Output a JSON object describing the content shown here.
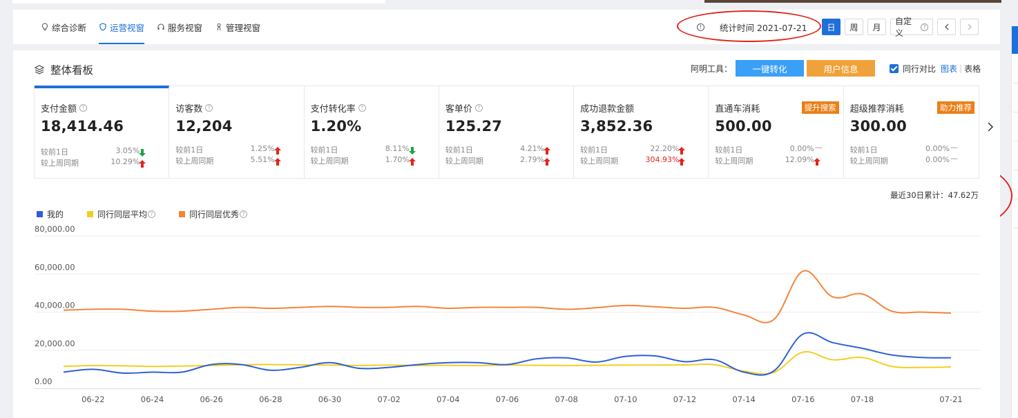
{
  "tabs": [
    {
      "label": "综合诊断",
      "icon": "bulb-icon",
      "active": false
    },
    {
      "label": "运营视窗",
      "icon": "shield-icon",
      "active": true
    },
    {
      "label": "服务视窗",
      "icon": "headset-icon",
      "active": false
    },
    {
      "label": "管理视窗",
      "icon": "user-icon",
      "active": false
    }
  ],
  "stat_time": "统计时间 2021-07-21",
  "period_buttons": {
    "day": "日",
    "week": "周",
    "month": "月",
    "custom": "自定义"
  },
  "panel": {
    "title": "整体看板",
    "tools_label": "阿明工具：",
    "btn_convert": "一键转化",
    "btn_userinfo": "用户信息",
    "compare_label": "同行对比",
    "view_chart": "图表",
    "view_table": "表格",
    "cumulative": "最近30日累计：47.62万"
  },
  "colors": {
    "accent": "#1e6fd9",
    "up": "#e2231a",
    "down": "#1aa34a",
    "badge": "#ea7f16",
    "series_mine": "#2e5fd6",
    "series_avg": "#f2cf1f",
    "series_best": "#f4843a"
  },
  "cards": [
    {
      "name": "支付金额",
      "value": "18,414.46",
      "help": true,
      "active": true,
      "rows": [
        {
          "label": "较前1日",
          "pct": "3.05%",
          "dir": "down"
        },
        {
          "label": "较上周同期",
          "pct": "10.29%",
          "dir": "up"
        }
      ]
    },
    {
      "name": "访客数",
      "value": "12,204",
      "help": true,
      "rows": [
        {
          "label": "较前1日",
          "pct": "1.25%",
          "dir": "up"
        },
        {
          "label": "较上周同期",
          "pct": "5.51%",
          "dir": "up"
        }
      ]
    },
    {
      "name": "支付转化率",
      "value": "1.20%",
      "help": true,
      "rows": [
        {
          "label": "较前1日",
          "pct": "8.11%",
          "dir": "down"
        },
        {
          "label": "较上周同期",
          "pct": "1.70%",
          "dir": "up"
        }
      ]
    },
    {
      "name": "客单价",
      "value": "125.27",
      "help": true,
      "rows": [
        {
          "label": "较前1日",
          "pct": "4.21%",
          "dir": "up"
        },
        {
          "label": "较上周同期",
          "pct": "2.79%",
          "dir": "up"
        }
      ]
    },
    {
      "name": "成功退款金额",
      "value": "3,852.36",
      "help": false,
      "rows": [
        {
          "label": "较前1日",
          "pct": "22.20%",
          "dir": "up"
        },
        {
          "label": "较上周同期",
          "pct": "304.93%",
          "dir": "up",
          "red": true
        }
      ]
    },
    {
      "name": "直通车消耗",
      "value": "500.00",
      "help": false,
      "badge": "提升搜索",
      "rows": [
        {
          "label": "较前1日",
          "pct": "0.00%",
          "dir": "flat"
        },
        {
          "label": "较上周同期",
          "pct": "12.09%",
          "dir": "up"
        }
      ]
    },
    {
      "name": "超级推荐消耗",
      "value": "300.00",
      "help": false,
      "badge": "助力推荐",
      "rows": [
        {
          "label": "较前1日",
          "pct": "0.00%",
          "dir": "flat"
        },
        {
          "label": "较上周同期",
          "pct": "0.00%",
          "dir": "flat"
        }
      ]
    }
  ],
  "chart_data": {
    "type": "line",
    "x": [
      "06-21",
      "06-22",
      "06-23",
      "06-24",
      "06-25",
      "06-26",
      "06-27",
      "06-28",
      "06-29",
      "06-30",
      "07-01",
      "07-02",
      "07-03",
      "07-04",
      "07-05",
      "07-06",
      "07-07",
      "07-08",
      "07-09",
      "07-10",
      "07-11",
      "07-12",
      "07-13",
      "07-14",
      "07-15",
      "07-16",
      "07-17",
      "07-18",
      "07-19",
      "07-20",
      "07-21"
    ],
    "x_tick_labels": [
      "06-22",
      "06-24",
      "06-26",
      "06-28",
      "06-30",
      "07-02",
      "07-04",
      "07-06",
      "07-08",
      "07-10",
      "07-12",
      "07-14",
      "07-16",
      "07-18",
      "07-21"
    ],
    "y_ticks": [
      "80,000.00",
      "60,000.00",
      "40,000.00",
      "20,000.00",
      "0.00"
    ],
    "ylim": [
      0,
      80000
    ],
    "series": [
      {
        "name": "我的",
        "values": [
          8500,
          10000,
          8000,
          8500,
          8500,
          12500,
          12500,
          9500,
          11000,
          13500,
          10500,
          11000,
          12500,
          13500,
          13500,
          12500,
          15500,
          16000,
          13800,
          16800,
          17000,
          14000,
          15000,
          8500,
          9000,
          28500,
          24000,
          21000,
          17500,
          16200,
          16000
        ]
      },
      {
        "name": "同行同层平均",
        "values": [
          11500,
          12000,
          11800,
          11500,
          11700,
          12000,
          12300,
          12500,
          12300,
          12200,
          12000,
          12200,
          12000,
          12100,
          12000,
          12200,
          12100,
          12000,
          12100,
          12200,
          12200,
          12300,
          12400,
          9000,
          8300,
          19000,
          15000,
          16200,
          11500,
          11000,
          11200
        ]
      },
      {
        "name": "同行同层优秀",
        "values": [
          41000,
          41500,
          41500,
          40500,
          40500,
          41500,
          42500,
          42000,
          42500,
          43000,
          42500,
          42500,
          43000,
          42000,
          42500,
          42500,
          42500,
          41500,
          42300,
          43500,
          42800,
          42000,
          42500,
          38500,
          36000,
          61500,
          48000,
          49500,
          40500,
          40000,
          39500
        ]
      }
    ],
    "legend": "top-left",
    "grid": true
  }
}
